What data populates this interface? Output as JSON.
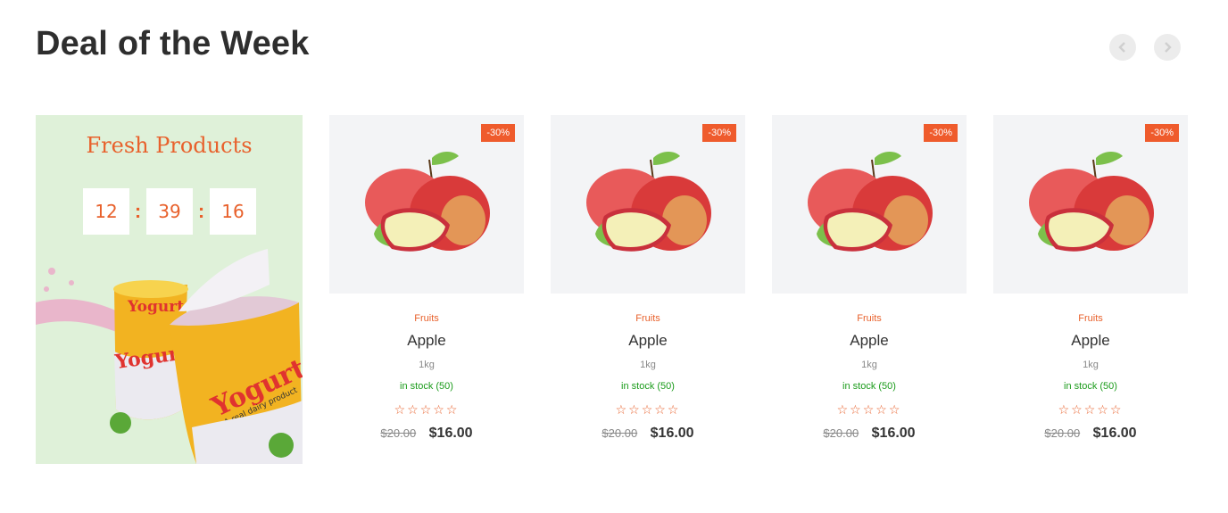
{
  "section": {
    "title": "Deal of the Week",
    "prev_icon": "chevron-left-icon",
    "next_icon": "chevron-right-icon"
  },
  "promo": {
    "title": "Fresh Products",
    "timer": {
      "hours": "12",
      "minutes": "39",
      "seconds": "16",
      "separator": ":"
    },
    "image_text": [
      "Yogurt",
      "Yogurt",
      "A real dairy product"
    ]
  },
  "products": [
    {
      "badge": "-30%",
      "category": "Fruits",
      "name": "Apple",
      "weight": "1kg",
      "stock": "in stock (50)",
      "rating": 0,
      "stars": "☆☆☆☆☆",
      "old_price": "$20.00",
      "price": "$16.00"
    },
    {
      "badge": "-30%",
      "category": "Fruits",
      "name": "Apple",
      "weight": "1kg",
      "stock": "in stock (50)",
      "rating": 0,
      "stars": "☆☆☆☆☆",
      "old_price": "$20.00",
      "price": "$16.00"
    },
    {
      "badge": "-30%",
      "category": "Fruits",
      "name": "Apple",
      "weight": "1kg",
      "stock": "in stock (50)",
      "rating": 0,
      "stars": "☆☆☆☆☆",
      "old_price": "$20.00",
      "price": "$16.00"
    },
    {
      "badge": "-30%",
      "category": "Fruits",
      "name": "Apple",
      "weight": "1kg",
      "stock": "in stock (50)",
      "rating": 0,
      "stars": "☆☆☆☆☆",
      "old_price": "$20.00",
      "price": "$16.00"
    }
  ],
  "colors": {
    "accent": "#e8612c",
    "badge": "#ef5b2c",
    "stock": "#1a9b1a",
    "promo_bg": "#dff1d9",
    "card_bg": "#f3f4f6"
  }
}
